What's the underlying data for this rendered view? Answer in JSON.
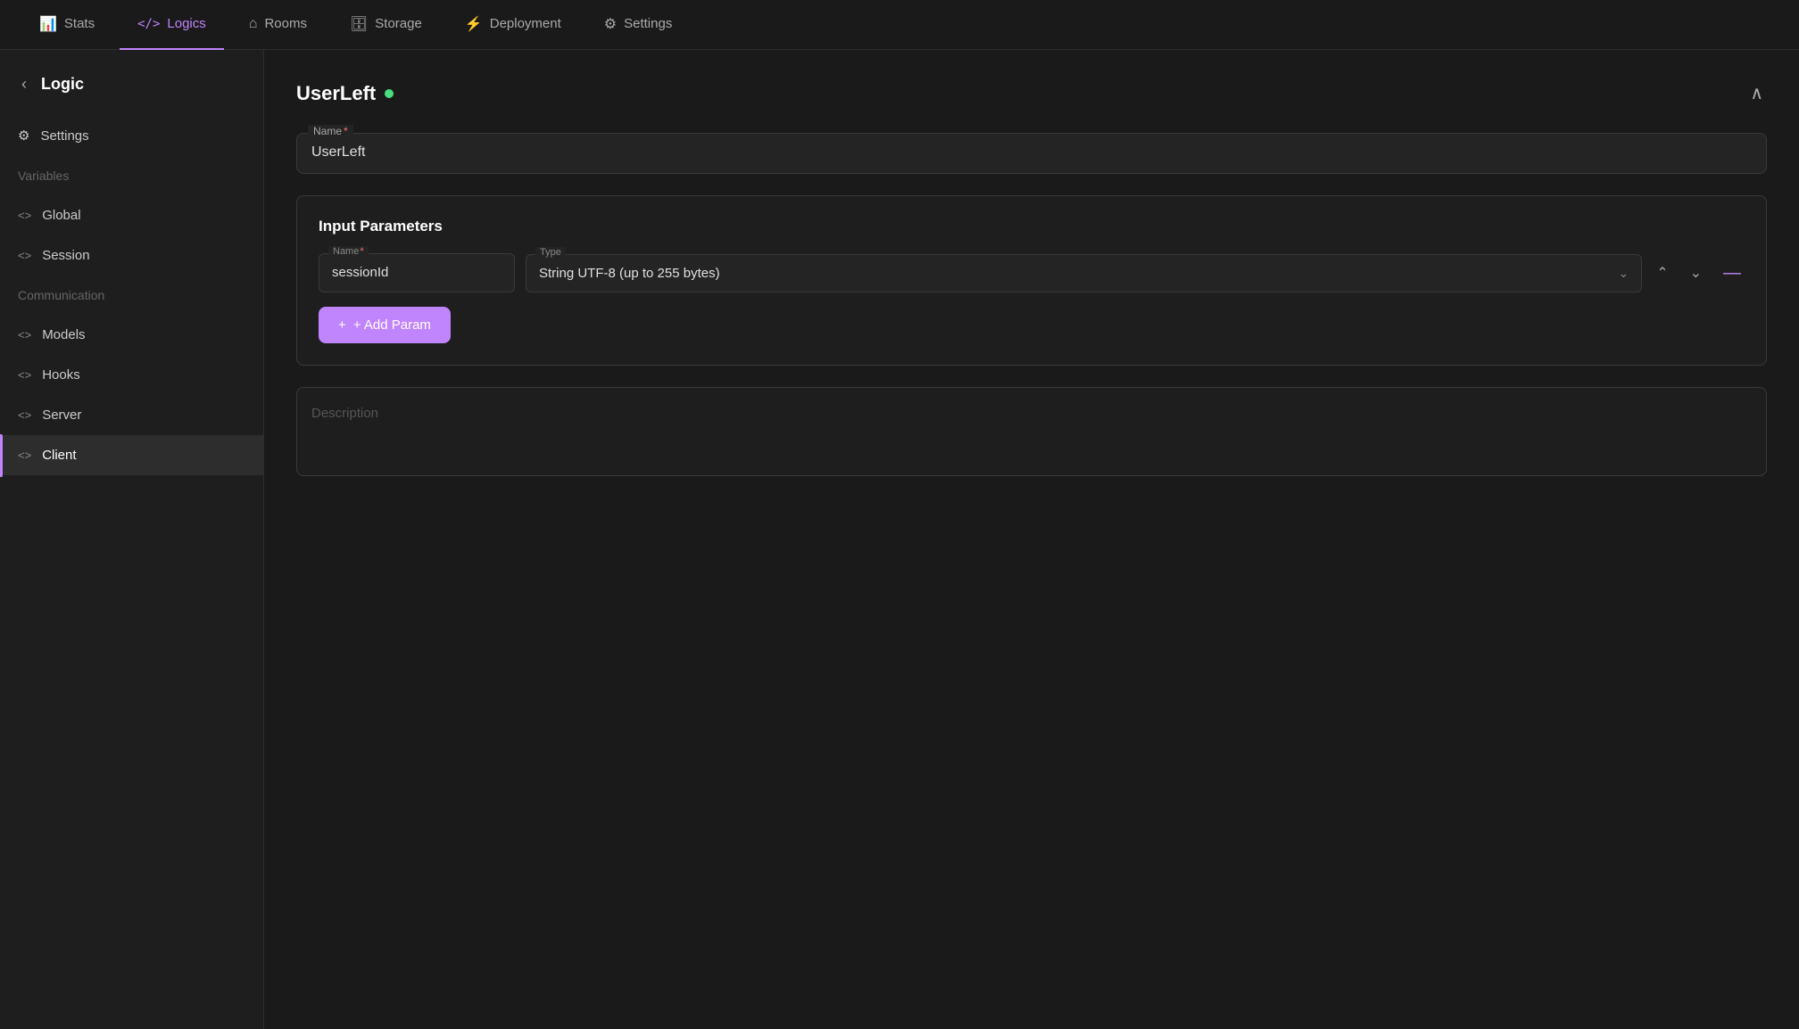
{
  "nav": {
    "tabs": [
      {
        "id": "stats",
        "label": "Stats",
        "icon": "📊",
        "active": false
      },
      {
        "id": "logics",
        "label": "Logics",
        "icon": "</>",
        "active": true
      },
      {
        "id": "rooms",
        "label": "Rooms",
        "icon": "🏠",
        "active": false
      },
      {
        "id": "storage",
        "label": "Storage",
        "icon": "🗄",
        "active": false
      },
      {
        "id": "deployment",
        "label": "Deployment",
        "icon": "⚡",
        "active": false
      },
      {
        "id": "settings",
        "label": "Settings",
        "icon": "⚙",
        "active": false
      }
    ]
  },
  "sidebar": {
    "back_label": "‹",
    "title": "Logic",
    "items": [
      {
        "id": "settings",
        "label": "Settings",
        "icon": "⚙",
        "type": "icon",
        "active": false
      },
      {
        "id": "variables",
        "label": "Variables",
        "icon": "",
        "type": "category",
        "active": false
      },
      {
        "id": "global",
        "label": "Global",
        "icon": "<>",
        "type": "code",
        "active": false
      },
      {
        "id": "session",
        "label": "Session",
        "icon": "<>",
        "type": "code",
        "active": false
      },
      {
        "id": "communication",
        "label": "Communication",
        "icon": "",
        "type": "category",
        "active": false
      },
      {
        "id": "models",
        "label": "Models",
        "icon": "<>",
        "type": "code",
        "active": false
      },
      {
        "id": "hooks",
        "label": "Hooks",
        "icon": "<>",
        "type": "code",
        "active": false
      },
      {
        "id": "server",
        "label": "Server",
        "icon": "<>",
        "type": "code",
        "active": false
      },
      {
        "id": "client",
        "label": "Client",
        "icon": "<>",
        "type": "code",
        "active": true
      }
    ]
  },
  "main": {
    "logic_name": "UserLeft",
    "status": "active",
    "name_label": "Name",
    "name_required": "*",
    "name_value": "UserLeft",
    "params_title": "Input Parameters",
    "param": {
      "name_label": "Name",
      "name_required": "*",
      "name_value": "sessionId",
      "type_label": "Type",
      "type_value": "String UTF-8 (up to 255 bytes)"
    },
    "add_param_label": "+ Add Param",
    "description_placeholder": "Description",
    "collapse_icon": "∧"
  }
}
